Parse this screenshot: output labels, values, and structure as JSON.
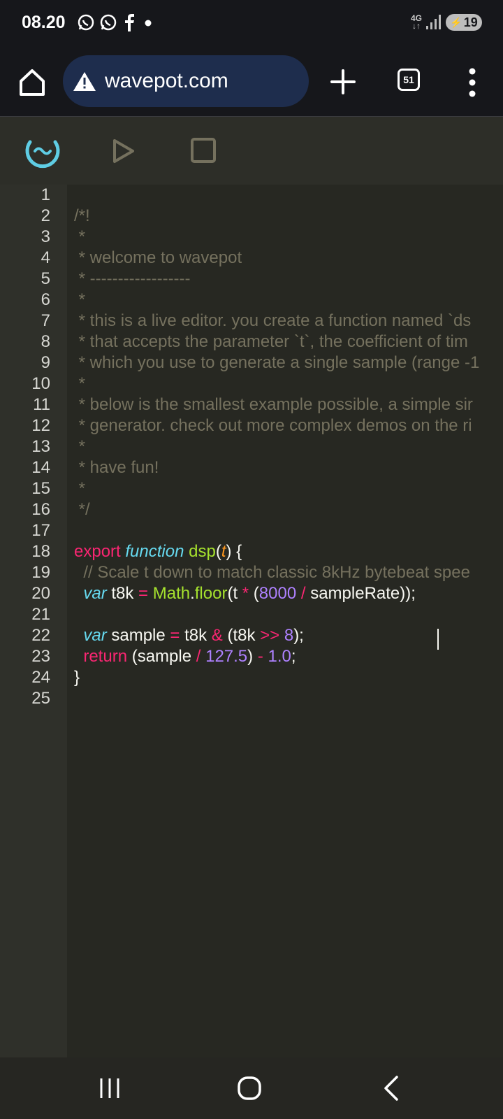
{
  "status_bar": {
    "time": "08.20",
    "network": "4G",
    "battery": "19",
    "icons": [
      "whatsapp-icon",
      "whatsapp-icon",
      "facebook-icon",
      "notification-dot-icon",
      "signal-icon",
      "battery-icon"
    ]
  },
  "browser": {
    "url": "wavepot.com",
    "tab_count": "51",
    "icons": [
      "home-icon",
      "warning-icon",
      "plus-icon",
      "tabs-icon",
      "more-vert-icon"
    ],
    "url_pill_color": "#1e2d4d"
  },
  "toolbar": {
    "icons": [
      "wavepot-logo-icon",
      "play-icon",
      "stop-icon"
    ],
    "logo_color": "#5fcde4"
  },
  "editor": {
    "line_numbers": [
      "1",
      "2",
      "3",
      "4",
      "5",
      "6",
      "7",
      "8",
      "9",
      "10",
      "11",
      "12",
      "13",
      "14",
      "15",
      "16",
      "17",
      "18",
      "19",
      "20",
      "21",
      "22",
      "23",
      "24",
      "25"
    ],
    "comment_lines": [
      "",
      "/*!",
      " *",
      " * welcome to wavepot",
      " * ------------------",
      " *",
      " * this is a live editor. you create a function named `ds",
      " * that accepts the parameter `t`, the coefficient of tim",
      " * which you use to generate a single sample (range -1",
      " *",
      " * below is the smallest example possible, a simple sir",
      " * generator. check out more complex demos on the ri",
      " *",
      " * have fun!",
      " *",
      " */",
      ""
    ],
    "l18": {
      "export": "export",
      "function": "function",
      "name": "dsp",
      "open": "(",
      "param": "t",
      "close": ") {"
    },
    "l19": "  // Scale t down to match classic 8kHz bytebeat spee",
    "l20": {
      "indent": "  ",
      "var": "var",
      "a": " t8k ",
      "eq": "=",
      "math": " Math",
      "dot": ".",
      "floor": "floor",
      "b": "(t ",
      "mul": "*",
      "c": " (",
      "n1": "8000",
      "d": " ",
      "div": "/",
      "e": " sampleRate));"
    },
    "l22": {
      "indent": "  ",
      "var": "var",
      "a": " sample ",
      "eq": "=",
      "b": " t8k ",
      "and": "&",
      "c": " (t8k ",
      "shr": ">>",
      "d": " ",
      "n1": "8",
      "e": ");"
    },
    "l23": {
      "indent": "  ",
      "ret": "return",
      "a": " (sample ",
      "div": "/",
      "b": " ",
      "n1": "127.5",
      "c": ") ",
      "minus": "-",
      "d": " ",
      "n2": "1.0",
      "e": ";"
    },
    "l24": "}",
    "theme": {
      "background": "#272822",
      "gutter": "#2f302a",
      "comment": "#75715e",
      "keyword": "#f92672",
      "storage": "#66d9ef",
      "function": "#a6e22e",
      "number": "#ae81ff",
      "parameter": "#fd971f"
    }
  },
  "nav_bar": {
    "icons": [
      "recent-apps-icon",
      "home-circle-icon",
      "back-icon"
    ]
  }
}
